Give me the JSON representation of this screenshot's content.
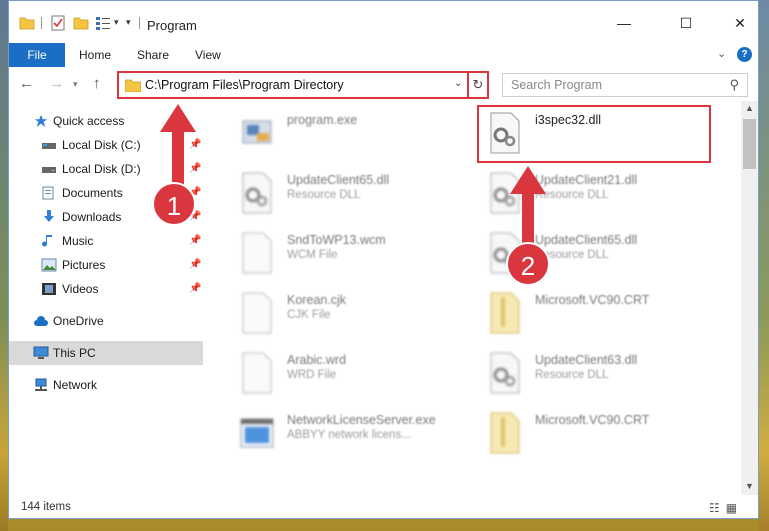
{
  "window": {
    "title": "Program",
    "minimize": "—",
    "maximize": "☐",
    "close": "✕"
  },
  "ribbon": {
    "tabs": [
      "File",
      "Home",
      "Share",
      "View"
    ],
    "help": "?"
  },
  "address": {
    "path": "C:\\Program Files\\Program Directory",
    "search_placeholder": "Search Program"
  },
  "sidebar": {
    "items": [
      {
        "label": "Quick access",
        "icon": "star-icon"
      },
      {
        "label": "Local Disk (C:)",
        "icon": "drive-icon",
        "pinned": true
      },
      {
        "label": "Local Disk (D:)",
        "icon": "drive-icon",
        "pinned": true
      },
      {
        "label": "Documents",
        "icon": "documents-icon",
        "pinned": true
      },
      {
        "label": "Downloads",
        "icon": "download-icon",
        "pinned": true
      },
      {
        "label": "Music",
        "icon": "music-icon",
        "pinned": true
      },
      {
        "label": "Pictures",
        "icon": "pictures-icon",
        "pinned": true
      },
      {
        "label": "Videos",
        "icon": "videos-icon",
        "pinned": true
      },
      {
        "label": "OneDrive",
        "icon": "cloud-icon"
      },
      {
        "label": "This PC",
        "icon": "pc-icon",
        "selected": true
      },
      {
        "label": "Network",
        "icon": "network-icon"
      }
    ]
  },
  "files": [
    {
      "name": "program.exe",
      "type": "",
      "icon": "exe-icon"
    },
    {
      "name": "i3spec32.dll",
      "type": "",
      "icon": "dll-gear-icon",
      "highlighted": true
    },
    {
      "name": "UpdateClient65.dll",
      "type": "Resource DLL",
      "icon": "dll-gear-icon"
    },
    {
      "name": "UpdateClient21.dll",
      "type": "Resource DLL",
      "icon": "dll-gear-icon"
    },
    {
      "name": "SndToWP13.wcm",
      "type": "WCM File",
      "icon": "blank-file-icon"
    },
    {
      "name": "UpdateClient65.dll",
      "type": "Resource DLL",
      "icon": "dll-gear-icon"
    },
    {
      "name": "Korean.cjk",
      "type": "CJK File",
      "icon": "blank-file-icon"
    },
    {
      "name": "Microsoft.VC90.CRT",
      "type": "",
      "icon": "folder-zip-icon"
    },
    {
      "name": "Arabic.wrd",
      "type": "WRD File",
      "icon": "blank-file-icon"
    },
    {
      "name": "UpdateClient63.dll",
      "type": "Resource DLL",
      "icon": "dll-gear-icon"
    },
    {
      "name": "NetworkLicenseServer.exe",
      "type": "ABBYY network licens...",
      "icon": "app-window-icon"
    },
    {
      "name": "Microsoft.VC90.CRT",
      "type": "",
      "icon": "folder-zip-icon"
    }
  ],
  "status": {
    "count": "144 items"
  },
  "annotations": {
    "step1": "1",
    "step2": "2",
    "color": "#d9363e"
  }
}
